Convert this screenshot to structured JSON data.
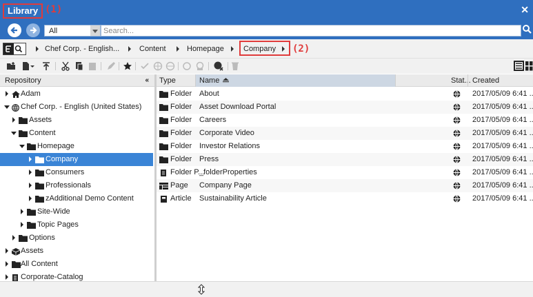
{
  "window": {
    "title": "Library",
    "annotation_1": "(1)",
    "close_icon": "close-icon"
  },
  "search": {
    "scope": "All",
    "placeholder": "Search..."
  },
  "breadcrumb": {
    "items": [
      "Chef Corp. - English...",
      "Content",
      "Homepage",
      "Company"
    ],
    "annotation_2": "(2)"
  },
  "tree": {
    "header": "Repository",
    "items": [
      {
        "label": "Adam",
        "icon": "home-icon"
      },
      {
        "label": "Chef Corp. - English (United States)",
        "icon": "globe-icon"
      },
      {
        "label": "Assets",
        "icon": "folder-icon"
      },
      {
        "label": "Content",
        "icon": "folder-icon"
      },
      {
        "label": "Homepage",
        "icon": "folder-icon"
      },
      {
        "label": "Company",
        "icon": "folder-icon"
      },
      {
        "label": "Consumers",
        "icon": "folder-icon"
      },
      {
        "label": "Professionals",
        "icon": "folder-icon"
      },
      {
        "label": "zAdditional Demo Content",
        "icon": "folder-icon"
      },
      {
        "label": "Site-Wide",
        "icon": "folder-icon"
      },
      {
        "label": "Topic Pages",
        "icon": "folder-icon"
      },
      {
        "label": "Options",
        "icon": "folder-icon"
      },
      {
        "label": "Assets",
        "icon": "cube-icon"
      },
      {
        "label": "All Content",
        "icon": "folder-icon"
      },
      {
        "label": "Corporate-Catalog",
        "icon": "catalog-icon"
      }
    ]
  },
  "list": {
    "columns": {
      "type": "Type",
      "name": "Name",
      "status": "Stat...",
      "created": "Created"
    },
    "rows": [
      {
        "type": "Folder",
        "name": "About",
        "created": "2017/05/09 6:41 ..."
      },
      {
        "type": "Folder",
        "name": "Asset Download Portal",
        "created": "2017/05/09 6:41 ..."
      },
      {
        "type": "Folder",
        "name": "Careers",
        "created": "2017/05/09 6:41 ..."
      },
      {
        "type": "Folder",
        "name": "Corporate Video",
        "created": "2017/05/09 6:41 ..."
      },
      {
        "type": "Folder",
        "name": "Investor Relations",
        "created": "2017/05/09 6:41 ..."
      },
      {
        "type": "Folder",
        "name": "Press",
        "created": "2017/05/09 6:41 ..."
      },
      {
        "type": "Folder P...",
        "name": "_folderProperties",
        "created": "2017/05/09 6:41 ..."
      },
      {
        "type": "Page",
        "name": "Company Page",
        "created": "2017/05/09 6:41 ..."
      },
      {
        "type": "Article",
        "name": "Sustainability Article",
        "created": "2017/05/09 6:41 ..."
      }
    ]
  },
  "colors": {
    "accent": "#2f6fbf",
    "selection": "#3a84d6",
    "annotation": "#e03b3b"
  }
}
